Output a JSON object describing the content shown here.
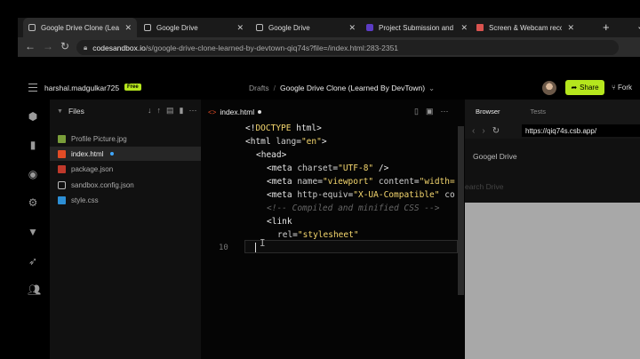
{
  "browser": {
    "tabs": [
      {
        "title": "Google Drive Clone (Lear",
        "icon": "tab-page-icon",
        "active": true
      },
      {
        "title": "Google Drive",
        "icon": "tab-page-icon",
        "active": false
      },
      {
        "title": "Google Drive",
        "icon": "tab-page-icon",
        "active": false
      },
      {
        "title": "Project Submission and A",
        "icon": "tab-purple-icon",
        "active": false
      },
      {
        "title": "Screen & Webcam record",
        "icon": "tab-red-icon",
        "active": false
      }
    ],
    "url_host": "codesandbox.io",
    "url_path": "/s/google-drive-clone-learned-by-devtown-qiq74s?file=/index.html:283-2351"
  },
  "header": {
    "username": "harshal.madgulkar725",
    "plan_badge": "Free",
    "breadcrumb_root": "Drafts",
    "breadcrumb_sep": "/",
    "project_name": "Google Drive Clone (Learned By DevTown)",
    "share_label": "Share",
    "fork_label": "Fork"
  },
  "files_panel": {
    "title": "Files",
    "files": [
      {
        "name": "Profile Picture.jpg",
        "type": "img"
      },
      {
        "name": "index.html",
        "type": "html",
        "active": true
      },
      {
        "name": "package.json",
        "type": "json"
      },
      {
        "name": "sandbox.config.json",
        "type": "cfg"
      },
      {
        "name": "style.css",
        "type": "css"
      }
    ]
  },
  "editor": {
    "tab_label": "index.html",
    "current_line_number": "10",
    "lines": {
      "l1a": "<!",
      "l1b": "DOCTYPE",
      "l1c": " html",
      "l1d": ">",
      "l2a": "<html ",
      "l2b": "lang",
      "l2c": "=",
      "l2d": "\"en\"",
      "l2e": ">",
      "l3": "<head>",
      "l4a": "<meta ",
      "l4b": "charset",
      "l4c": "=",
      "l4d": "\"UTF-8\"",
      "l4e": " />",
      "l5a": "<meta ",
      "l5b": "name",
      "l5c": "=",
      "l5d": "\"viewport\"",
      "l5e": " content",
      "l5f": "=",
      "l5g": "\"width=",
      "l6a": "<meta ",
      "l6b": "http-equiv",
      "l6c": "=",
      "l6d": "\"X-UA-Compatible\"",
      "l6e": " co",
      "l7": "<!-- Compiled and minified CSS -->",
      "l8": "<link",
      "l9a": "rel",
      "l9b": "=",
      "l9c": "\"stylesheet\""
    }
  },
  "preview": {
    "tab_browser": "Browser",
    "tab_tests": "Tests",
    "url": "https://qiq74s.csb.app/",
    "page_title": "Googel Drive",
    "search_text": "earch Drive"
  }
}
